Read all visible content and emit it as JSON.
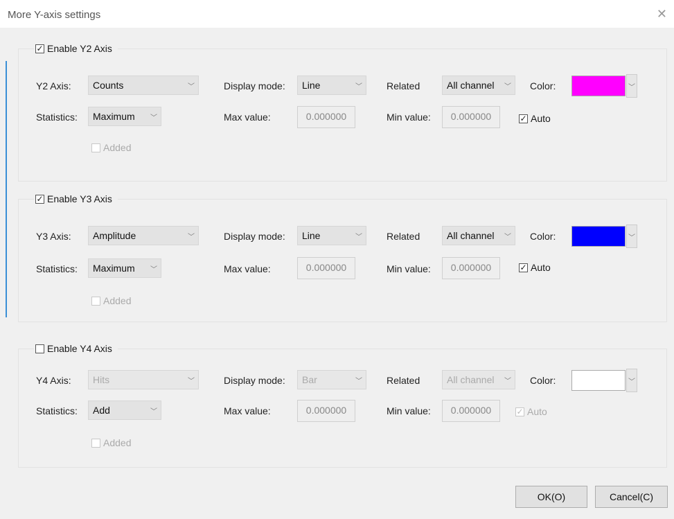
{
  "window": {
    "title": "More Y-axis settings",
    "close_glyph": "✕"
  },
  "sections": [
    {
      "legend": "Enable Y2 Axis",
      "enabled": true,
      "axis_label": "Y2 Axis:",
      "axis_value": "Counts",
      "display_mode_label": "Display mode:",
      "display_mode": "Line",
      "related_label": "Related",
      "related": "All channel",
      "color_label": "Color:",
      "color": "#ff00ff",
      "statistics_label": "Statistics:",
      "statistics": "Maximum",
      "max_label": "Max value:",
      "max_value": "0.000000",
      "min_label": "Min value:",
      "min_value": "0.000000",
      "auto_label": "Auto",
      "auto": true,
      "added_label": "Added"
    },
    {
      "legend": "Enable Y3 Axis",
      "enabled": true,
      "axis_label": "Y3 Axis:",
      "axis_value": "Amplitude",
      "display_mode_label": "Display mode:",
      "display_mode": "Line",
      "related_label": "Related",
      "related": "All channel",
      "color_label": "Color:",
      "color": "#0000ff",
      "statistics_label": "Statistics:",
      "statistics": "Maximum",
      "max_label": "Max value:",
      "max_value": "0.000000",
      "min_label": "Min value:",
      "min_value": "0.000000",
      "auto_label": "Auto",
      "auto": true,
      "added_label": "Added"
    },
    {
      "legend": "Enable Y4 Axis",
      "enabled": false,
      "axis_label": "Y4 Axis:",
      "axis_value": "Hits",
      "display_mode_label": "Display mode:",
      "display_mode": "Bar",
      "related_label": "Related",
      "related": "All channel",
      "color_label": "Color:",
      "color": "#ffffff",
      "statistics_label": "Statistics:",
      "statistics": "Add",
      "max_label": "Max value:",
      "max_value": "0.000000",
      "min_label": "Min value:",
      "min_value": "0.000000",
      "auto_label": "Auto",
      "auto": true,
      "added_label": "Added"
    }
  ],
  "buttons": {
    "ok": "OK(O)",
    "cancel": "Cancel(C)"
  },
  "check_glyph": "✓",
  "chevron_glyph": "﹀"
}
